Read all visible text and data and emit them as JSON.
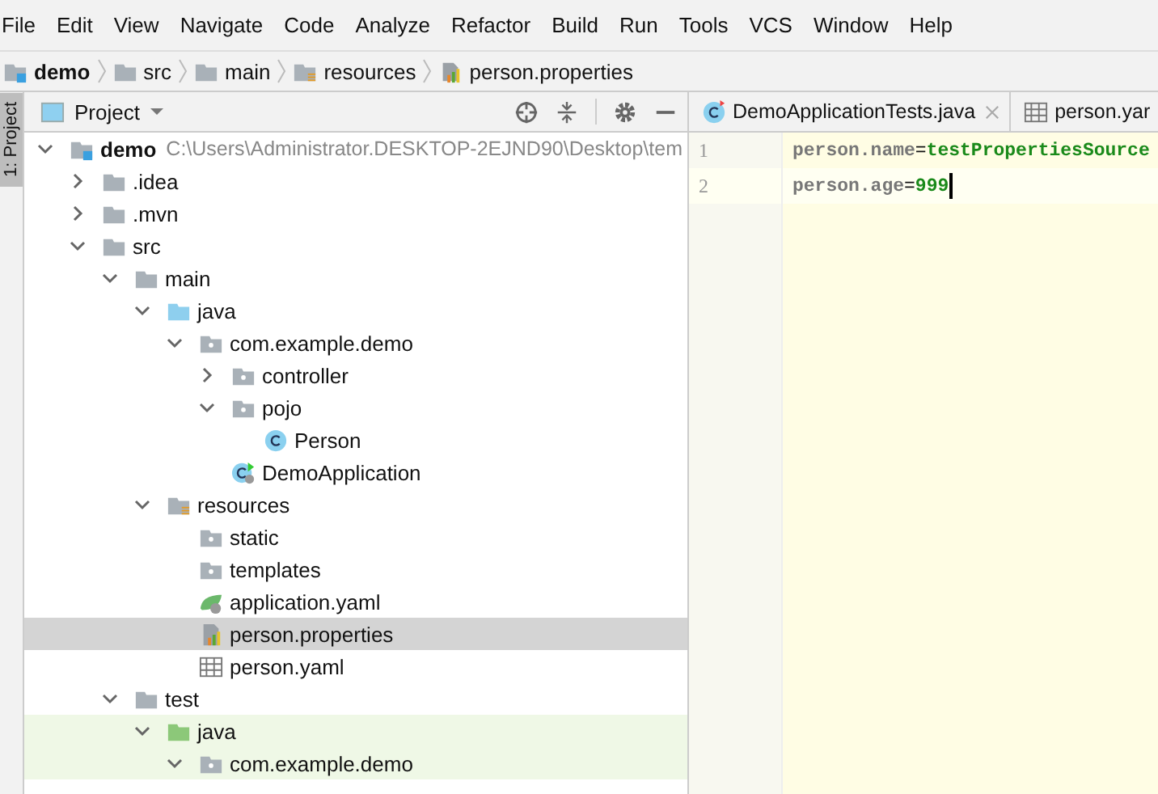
{
  "menu": [
    "File",
    "Edit",
    "View",
    "Navigate",
    "Code",
    "Analyze",
    "Refactor",
    "Build",
    "Run",
    "Tools",
    "VCS",
    "Window",
    "Help"
  ],
  "breadcrumb": [
    {
      "label": "demo",
      "kind": "module"
    },
    {
      "label": "src",
      "kind": "folder"
    },
    {
      "label": "main",
      "kind": "folder"
    },
    {
      "label": "resources",
      "kind": "resources"
    },
    {
      "label": "person.properties",
      "kind": "properties"
    }
  ],
  "tool_stripe": {
    "label": "1: Project",
    "selected": true
  },
  "project_panel": {
    "title": "Project",
    "tree": [
      {
        "name": "demo",
        "path": "C:\\Users\\Administrator.DESKTOP-2EJND90\\Desktop\\tem",
        "kind": "module",
        "expanded": true,
        "selected": false,
        "children": [
          {
            "name": ".idea",
            "kind": "folder",
            "expanded": false,
            "selected": false
          },
          {
            "name": ".mvn",
            "kind": "folder",
            "expanded": false,
            "selected": false
          },
          {
            "name": "src",
            "kind": "folder",
            "expanded": true,
            "selected": false,
            "children": [
              {
                "name": "main",
                "kind": "folder",
                "expanded": true,
                "selected": false,
                "children": [
                  {
                    "name": "java",
                    "kind": "source",
                    "expanded": true,
                    "selected": false,
                    "children": [
                      {
                        "name": "com.example.demo",
                        "kind": "package",
                        "expanded": true,
                        "selected": false,
                        "children": [
                          {
                            "name": "controller",
                            "kind": "package",
                            "expanded": false,
                            "selected": false
                          },
                          {
                            "name": "pojo",
                            "kind": "package",
                            "expanded": true,
                            "selected": false,
                            "children": [
                              {
                                "name": "Person",
                                "kind": "class",
                                "selected": false
                              }
                            ]
                          },
                          {
                            "name": "DemoApplication",
                            "kind": "spring-class",
                            "selected": false
                          }
                        ]
                      }
                    ]
                  },
                  {
                    "name": "resources",
                    "kind": "resources",
                    "expanded": true,
                    "selected": false,
                    "children": [
                      {
                        "name": "static",
                        "kind": "package",
                        "selected": false
                      },
                      {
                        "name": "templates",
                        "kind": "package",
                        "selected": false
                      },
                      {
                        "name": "application.yaml",
                        "kind": "spring-yaml",
                        "selected": false
                      },
                      {
                        "name": "person.properties",
                        "kind": "properties",
                        "selected": true
                      },
                      {
                        "name": "person.yaml",
                        "kind": "yaml",
                        "selected": false
                      }
                    ]
                  }
                ]
              },
              {
                "name": "test",
                "kind": "folder",
                "expanded": true,
                "selected": false,
                "children": [
                  {
                    "name": "java",
                    "kind": "test-source",
                    "expanded": true,
                    "selected": false,
                    "children": [
                      {
                        "name": "com.example.demo",
                        "kind": "package",
                        "expanded": true,
                        "selected": false
                      }
                    ]
                  }
                ]
              }
            ]
          }
        ]
      }
    ]
  },
  "editor": {
    "tabs": [
      {
        "label": "DemoApplicationTests.java",
        "kind": "test-class",
        "closable": true,
        "selected": false
      },
      {
        "label": "person.yar",
        "kind": "yaml",
        "closable": false,
        "selected": false
      }
    ],
    "lines": [
      {
        "number": "1",
        "key": "person.name",
        "sep": "=",
        "value": "testPropertiesSource",
        "current": false,
        "caret": false
      },
      {
        "number": "2",
        "key": "person.age",
        "sep": "=",
        "value": "999",
        "current": true,
        "caret": true
      }
    ]
  }
}
